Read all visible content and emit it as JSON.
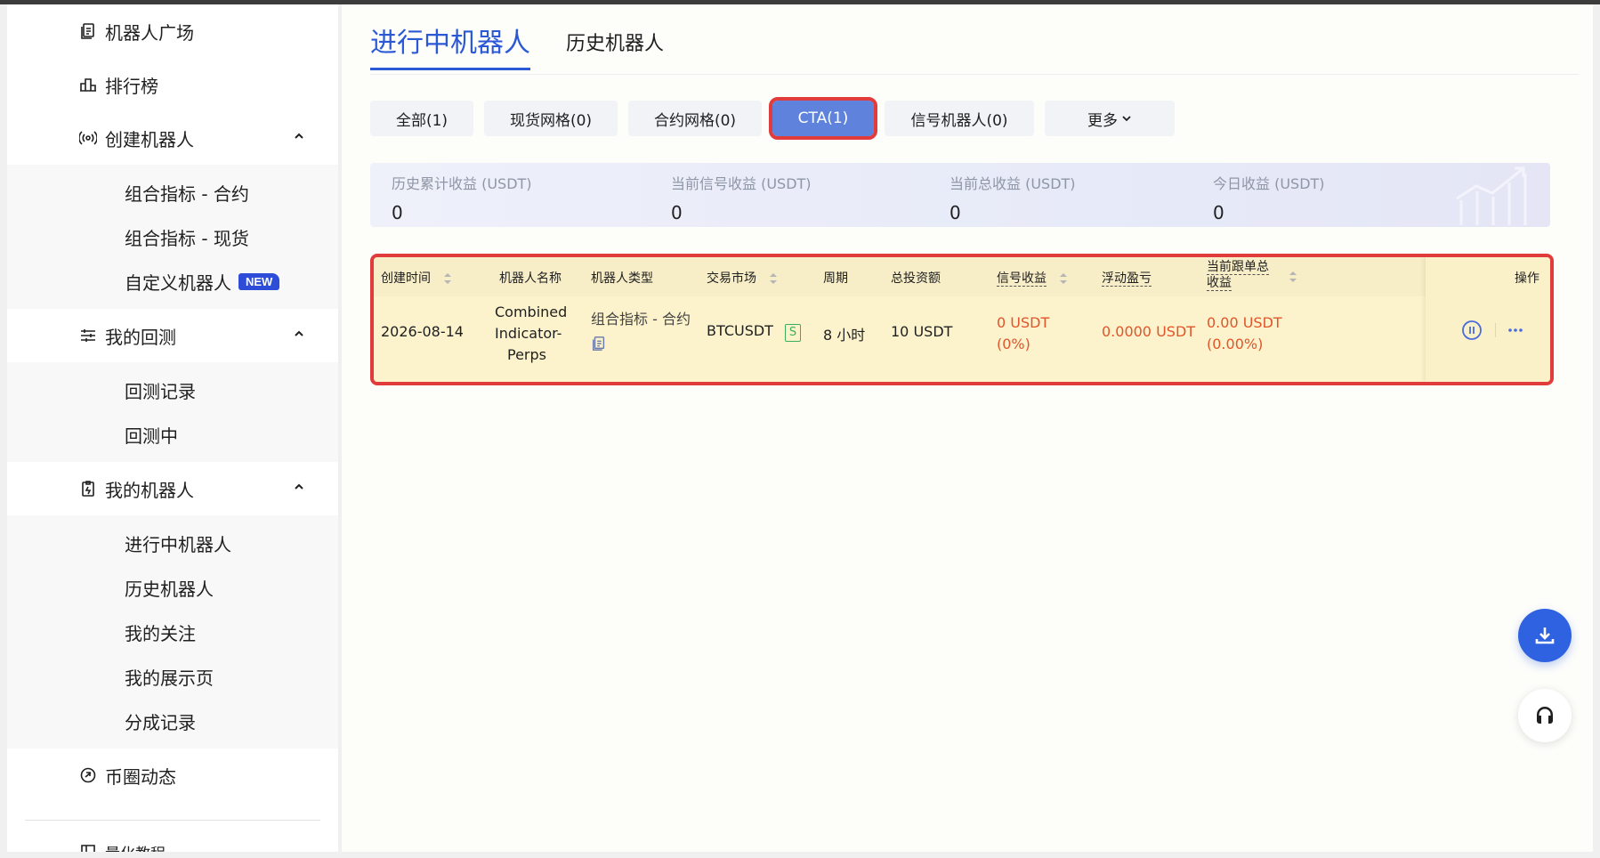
{
  "sidebar": {
    "plaza": "机器人广场",
    "ranking": "排行榜",
    "create": {
      "label": "创建机器人",
      "items": [
        "组合指标 - 合约",
        "组合指标 - 现货",
        "自定义机器人"
      ],
      "new_badge": "NEW"
    },
    "backtest": {
      "label": "我的回测",
      "items": [
        "回测记录",
        "回测中"
      ]
    },
    "my_robots": {
      "label": "我的机器人",
      "items": [
        "进行中机器人",
        "历史机器人",
        "我的关注",
        "我的展示页",
        "分成记录"
      ]
    },
    "news": "币圈动态",
    "tutorial": "量化教程"
  },
  "tabs": {
    "active": "进行中机器人",
    "history": "历史机器人"
  },
  "filters": {
    "all": "全部(1)",
    "spot_grid": "现货网格(0)",
    "contract_grid": "合约网格(0)",
    "cta": "CTA(1)",
    "signal": "信号机器人(0)",
    "more": "更多"
  },
  "stats": [
    {
      "label": "历史累计收益 (USDT)",
      "value": "0"
    },
    {
      "label": "当前信号收益 (USDT)",
      "value": "0"
    },
    {
      "label": "当前总收益 (USDT)",
      "value": "0"
    },
    {
      "label": "今日收益 (USDT)",
      "value": "0"
    }
  ],
  "table": {
    "headers": {
      "created": "创建时间",
      "name": "机器人名称",
      "type": "机器人类型",
      "market": "交易市场",
      "period": "周期",
      "investment": "总投资额",
      "signal_profit": "信号收益",
      "floating_pnl": "浮动盈亏",
      "copy_profit_1": "当前跟单总",
      "copy_profit_2": "收益",
      "action": "操作"
    },
    "row": {
      "created": "2026-08-14",
      "name_1": "Combined",
      "name_2": "Indicator-",
      "name_3": "Perps",
      "type": "组合指标 - 合约",
      "market": "BTCUSDT",
      "market_badge": "S",
      "period": "8 小时",
      "investment": "10 USDT",
      "signal_profit": "0 USDT",
      "signal_profit_pct": "(0%)",
      "floating_pnl": "0.0000 USDT",
      "copy_profit": "0.00 USDT",
      "copy_profit_pct": "(0.00%)"
    }
  },
  "colors": {
    "accent": "#2b59d6",
    "highlight": "#e23b3b",
    "profit": "#e2542a",
    "spot_badge": "#3fae5a"
  }
}
